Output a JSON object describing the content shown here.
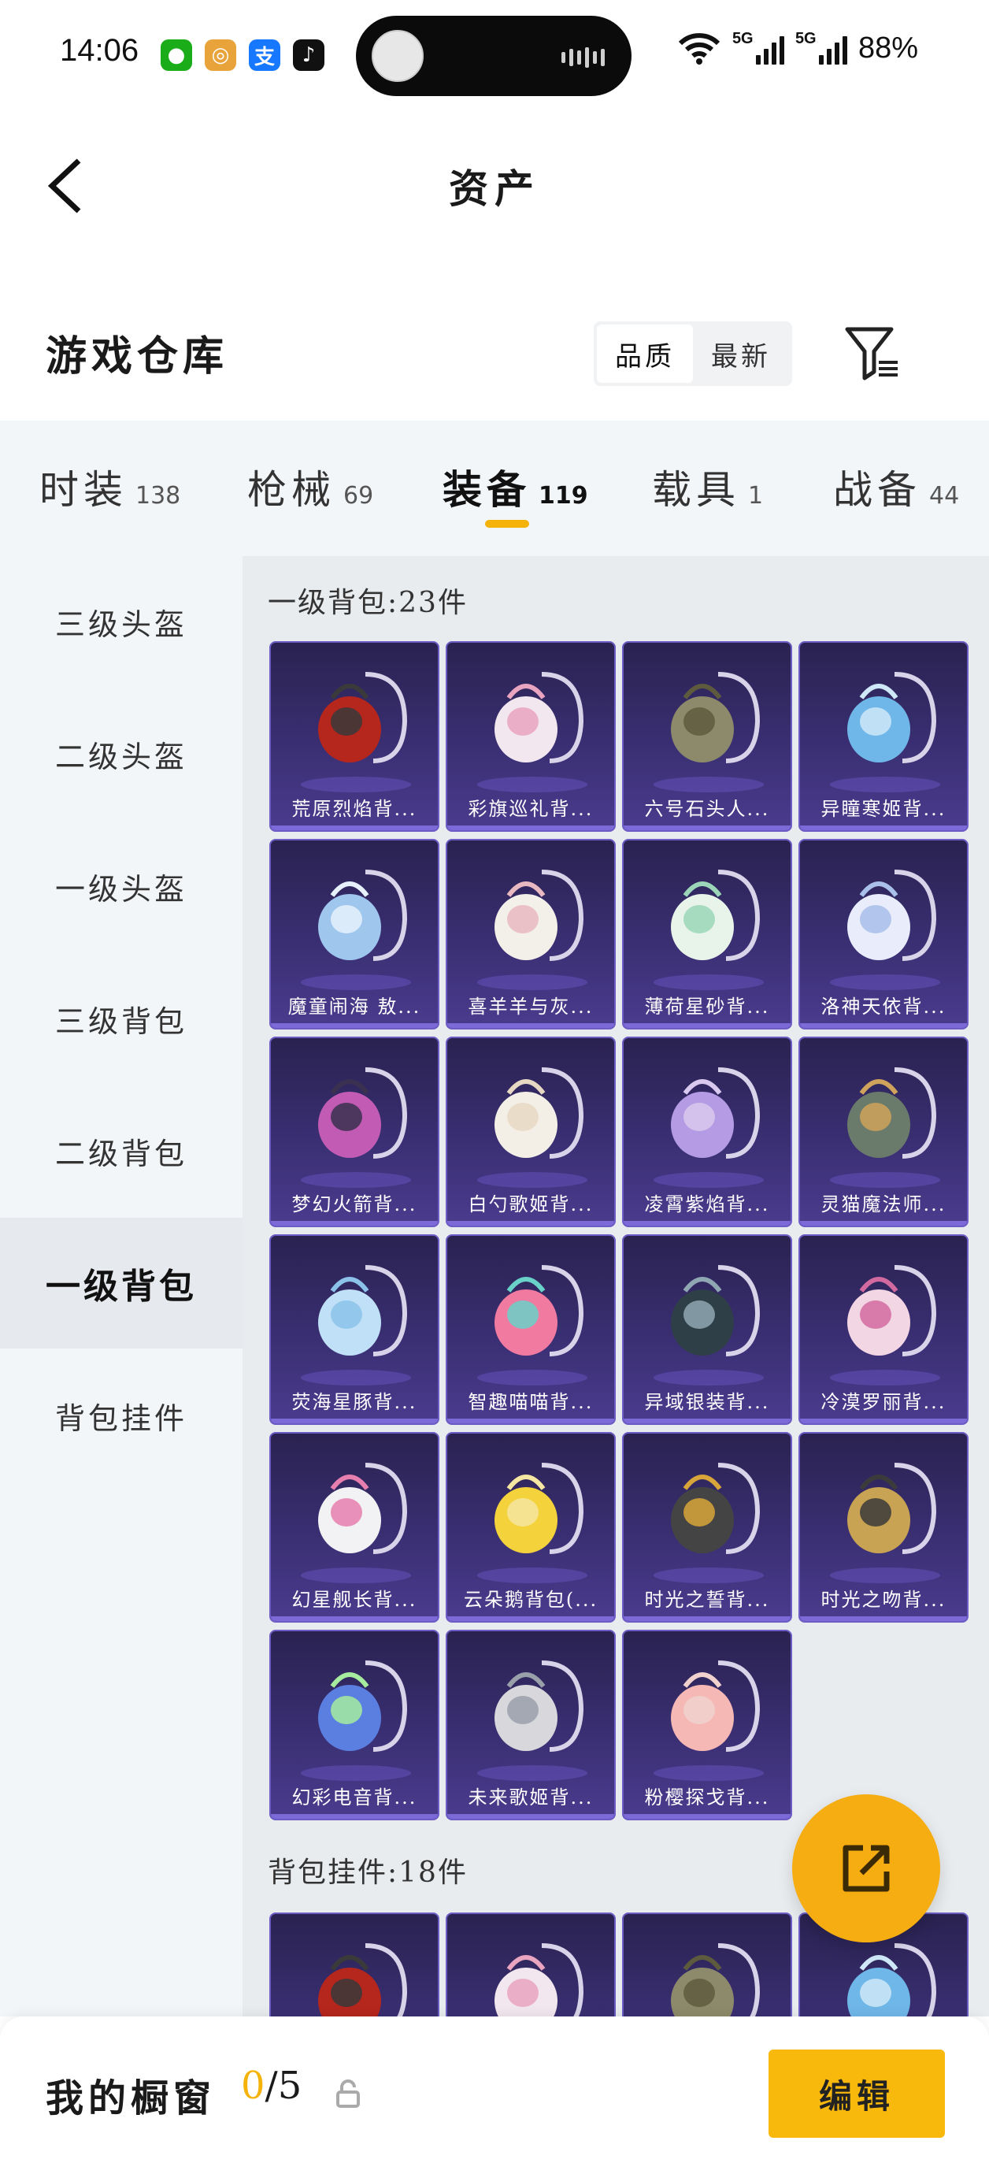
{
  "status_bar": {
    "time": "14:06",
    "network_1": "5G",
    "network_2": "5G",
    "battery": "88%",
    "app_icons": [
      "wechat-icon",
      "app-icon",
      "alipay-icon",
      "tiktok-icon"
    ]
  },
  "header": {
    "title": "资产",
    "back_icon": "back-chevron-icon"
  },
  "warehouse": {
    "title": "游戏仓库",
    "sort_options": [
      "品质",
      "最新"
    ],
    "sort_active": "品质",
    "filter_icon": "filter-icon"
  },
  "tabs": [
    {
      "label": "时装",
      "count": "138"
    },
    {
      "label": "枪械",
      "count": "69"
    },
    {
      "label": "装备",
      "count": "119",
      "active": true
    },
    {
      "label": "载具",
      "count": "1"
    },
    {
      "label": "战备",
      "count": "44"
    }
  ],
  "sidebar": {
    "items": [
      "三级头盔",
      "二级头盔",
      "一级头盔",
      "三级背包",
      "二级背包",
      "一级背包",
      "背包挂件"
    ],
    "active": "一级背包"
  },
  "groups": [
    {
      "title": "一级背包:23件",
      "items": [
        "荒原烈焰背...",
        "彩旗巡礼背...",
        "六号石头人...",
        "异瞳寒姬背...",
        "魔童闹海 敖...",
        "喜羊羊与灰...",
        "薄荷星砂背...",
        "洛神天依背...",
        "梦幻火箭背...",
        "白勺歌姬背...",
        "凌霄紫焰背...",
        "灵猫魔法师...",
        "荧海星豚背...",
        "智趣喵喵背...",
        "异域银装背...",
        "冷漠罗丽背...",
        "幻星舰长背...",
        "云朵鹅背包(...",
        "时光之誓背...",
        "时光之吻背...",
        "幻彩电音背...",
        "未来歌姬背...",
        "粉樱探戈背..."
      ]
    },
    {
      "title": "背包挂件:18件",
      "items": [
        "",
        "",
        "",
        ""
      ]
    }
  ],
  "colors": {
    "accent": "#f5b30a",
    "card_bg": "#3a2f73",
    "sidebar_bg": "#f3f6f9",
    "content_bg": "#e9ecef"
  },
  "fab_icon": "share-external-icon",
  "showcase": {
    "title": "我的橱窗",
    "count_current": "0",
    "count_total": "/5",
    "lock_icon": "lock-icon",
    "edit_label": "编辑"
  }
}
